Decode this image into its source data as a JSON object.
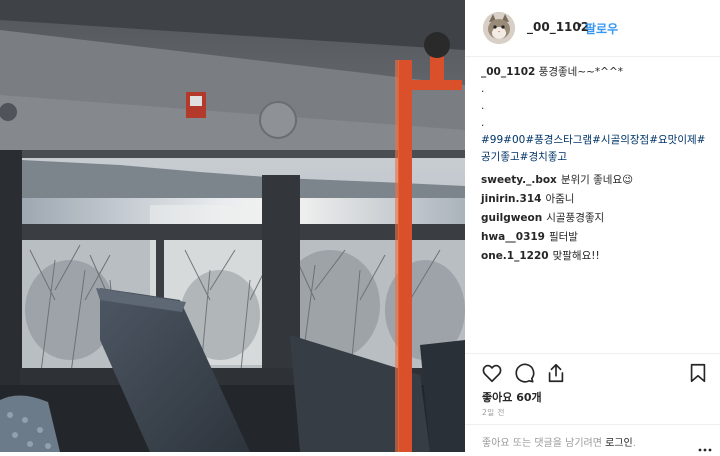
{
  "post": {
    "username": "_00_1102",
    "separator": "•",
    "follow_label": "팔로우",
    "caption_user": "_00_1102",
    "caption_text": " 풍경좋네~~*^^*",
    "caption_dots": [
      ".",
      ".",
      "."
    ],
    "hashtags": [
      "#99",
      "#00",
      "#풍경스타그램",
      "#시골의장점",
      "#요맛이제",
      "#공기좋고",
      "#경치좋고"
    ],
    "comments": [
      {
        "user": "sweety._.box",
        "text": "분위기 좋네요😉"
      },
      {
        "user": "jinirin.314",
        "text": "아줌니"
      },
      {
        "user": "guilgweon",
        "text": "시골풍경좋지"
      },
      {
        "user": "hwa__0319",
        "text": "필터발"
      },
      {
        "user": "one.1_1220",
        "text": "맞팔해요!!"
      }
    ],
    "likes_label": "좋아요 60개",
    "time_label": "2일 전",
    "login_prompt": "좋아요 또는 댓글을 남기려면 ",
    "login_link": "로그인",
    "login_end": ".",
    "icons": [
      "heart-icon",
      "comment-icon",
      "share-icon",
      "bookmark-icon",
      "more-icon"
    ],
    "accent_color": "#3897f0",
    "hashtag_color": "#003569"
  }
}
